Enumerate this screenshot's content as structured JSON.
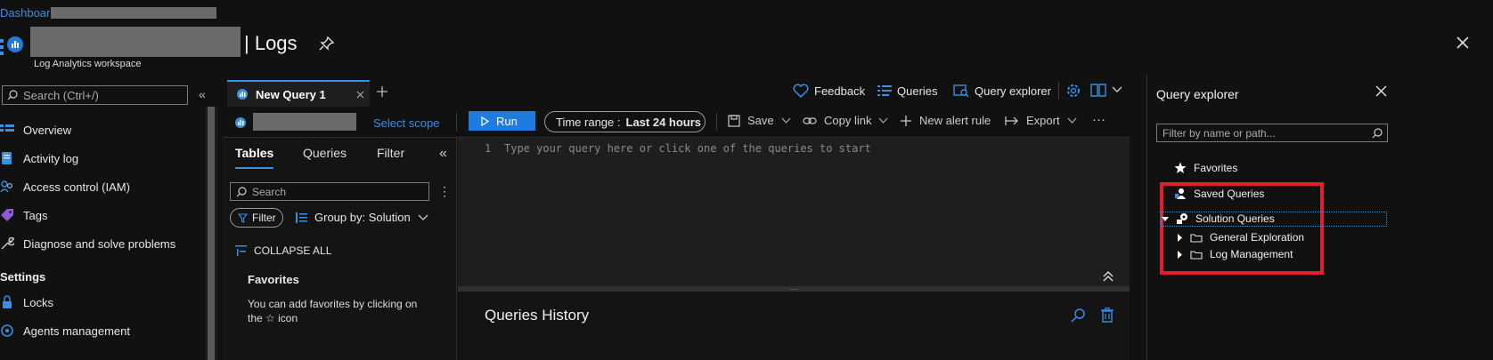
{
  "breadcrumb": {
    "root": "Dashboard",
    "separator": ">"
  },
  "header": {
    "title_suffix": "| Logs",
    "subtitle": "Log Analytics workspace"
  },
  "sidebar": {
    "search_placeholder": "Search (Ctrl+/)",
    "items": [
      {
        "label": "Overview",
        "icon": "overview-icon"
      },
      {
        "label": "Activity log",
        "icon": "activity-log-icon"
      },
      {
        "label": "Access control (IAM)",
        "icon": "people-icon"
      },
      {
        "label": "Tags",
        "icon": "tag-icon"
      },
      {
        "label": "Diagnose and solve problems",
        "icon": "wrench-icon"
      }
    ],
    "section_settings": "Settings",
    "settings_items": [
      {
        "label": "Locks",
        "icon": "lock-icon"
      },
      {
        "label": "Agents management",
        "icon": "agents-icon"
      }
    ]
  },
  "tabs": {
    "active_label": "New Query 1"
  },
  "top_actions": {
    "feedback": "Feedback",
    "queries": "Queries",
    "query_explorer": "Query explorer"
  },
  "toolbar": {
    "select_scope": "Select scope",
    "run": "Run",
    "time_range_label": "Time range :",
    "time_range_value": "Last 24 hours",
    "save": "Save",
    "copy_link": "Copy link",
    "new_alert_rule": "New alert rule",
    "export": "Export",
    "more": "···"
  },
  "left_panel": {
    "tabs": [
      "Tables",
      "Queries",
      "Filter"
    ],
    "search_placeholder": "Search",
    "filter_button": "Filter",
    "group_by": "Group by: Solution",
    "collapse_all": "COLLAPSE ALL",
    "favorites_title": "Favorites",
    "favorites_hint": "You can add favorites by clicking on the ☆ icon"
  },
  "editor": {
    "line_number": "1",
    "placeholder": "Type your query here or click one of the queries to start"
  },
  "history": {
    "title": "Queries History"
  },
  "query_explorer": {
    "title": "Query explorer",
    "filter_placeholder": "Filter by name or path...",
    "tree": {
      "favorites": "Favorites",
      "saved_queries": "Saved Queries",
      "solution_queries": "Solution Queries",
      "general_exploration": "General Exploration",
      "log_management": "Log Management"
    },
    "highlight_color": "#e0202a"
  }
}
